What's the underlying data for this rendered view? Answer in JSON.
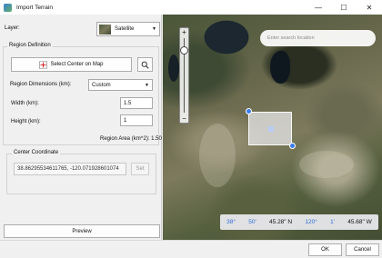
{
  "window": {
    "title": "Import Terrain",
    "minimize": "—",
    "maximize": "☐",
    "close": "✕"
  },
  "layer": {
    "label": "Layer:",
    "value": "Satellite"
  },
  "region_definition": {
    "title": "Region Definition",
    "select_center_label": "Select Center on Map",
    "dimensions_label": "Region Dimensions (km):",
    "dimensions_value": "Custom",
    "width_label": "Width (km):",
    "width_value": "1.5",
    "height_label": "Height (km):",
    "height_value": "1",
    "area_label": "Region Area (km^2): 1.50"
  },
  "center_coordinate": {
    "title": "Center Coordinate",
    "value": "38.86295534611765, -120.071928601074",
    "set_label": "Set"
  },
  "map": {
    "search_placeholder": "Enter search location",
    "zoom_in": "+",
    "zoom_out": "−",
    "coords": {
      "lat_deg": "38°",
      "lat_min": "50'",
      "lat_sec": "45.28\" N",
      "lon_deg": "120°",
      "lon_min": "1'",
      "lon_sec": "45.68\" W"
    }
  },
  "buttons": {
    "preview": "Preview",
    "ok": "OK",
    "cancel": "Cancel"
  },
  "colors": {
    "accent": "#3a7de8",
    "coord_text": "#2f6fd6"
  }
}
